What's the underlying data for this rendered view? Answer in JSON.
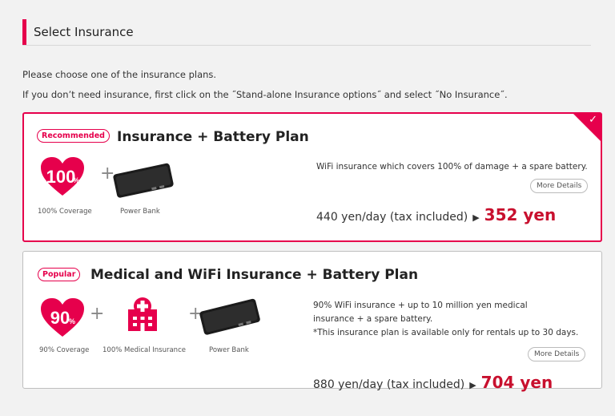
{
  "section": {
    "title": "Select Insurance"
  },
  "intro": {
    "line1": "Please choose one of the insurance plans.",
    "line2": "If you don’t need insurance, first click on the ˝Stand-alone Insurance options˝ and select ˝No Insurance˝."
  },
  "plans": [
    {
      "badge": "Recommended",
      "title": "Insurance + Battery Plan",
      "items": [
        {
          "icon": "heart-100-icon",
          "icon_text": "100",
          "icon_suffix": "%",
          "caption": "100% Coverage"
        },
        {
          "icon": "power-bank-icon",
          "caption": "Power Bank"
        }
      ],
      "description": "WiFi insurance which covers 100% of damage + a spare battery.",
      "more_details": "More Details",
      "price_daily": "440 yen/day (tax included)",
      "price_final": "352 yen"
    },
    {
      "badge": "Popular",
      "title": "Medical and WiFi Insurance + Battery Plan",
      "items": [
        {
          "icon": "heart-90-icon",
          "icon_text": "90",
          "icon_suffix": "%",
          "caption": "90% Coverage"
        },
        {
          "icon": "hospital-icon",
          "caption": "100% Medical Insurance"
        },
        {
          "icon": "power-bank-icon",
          "caption": "Power Bank"
        }
      ],
      "description": "90% WiFi insurance + up to 10 million yen medical insurance + a spare battery.",
      "note": "*This insurance plan is available only for rentals up to 30 days.",
      "more_details": "More Details",
      "price_daily": "880 yen/day (tax included)",
      "price_final": "704 yen"
    }
  ],
  "colors": {
    "accent": "#e6004c",
    "price": "#c8102e",
    "card_border": "#bfbfbf"
  }
}
